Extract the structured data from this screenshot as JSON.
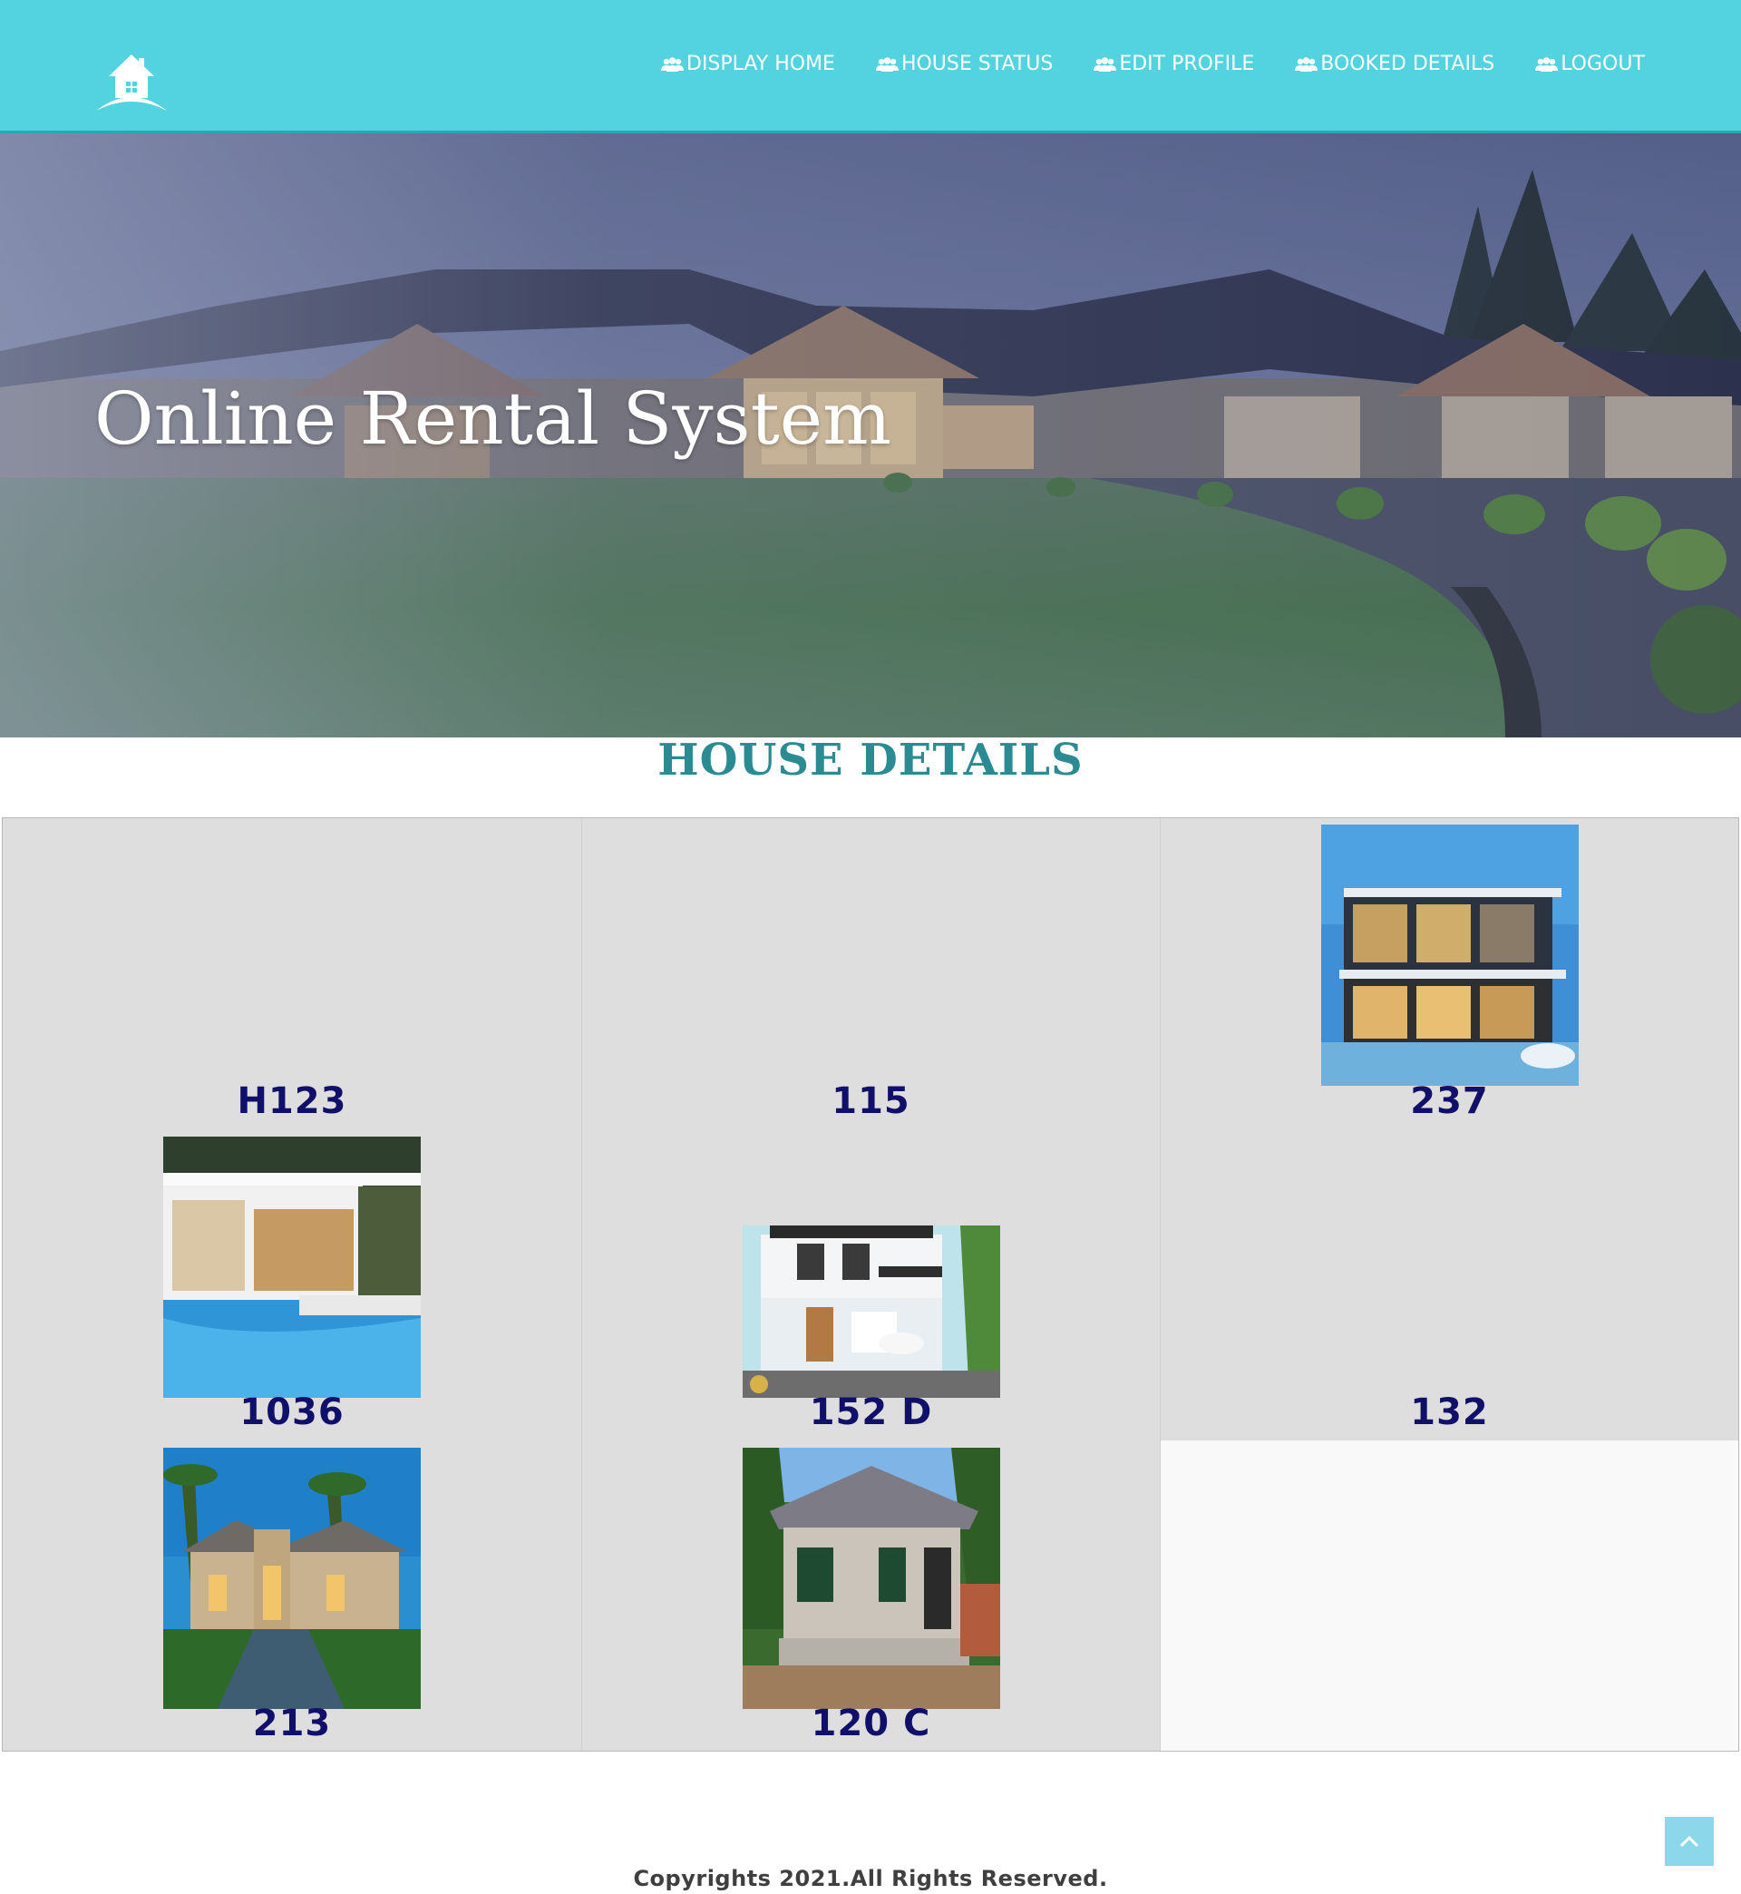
{
  "header": {
    "logo_icon": "house-logo-icon",
    "nav": [
      {
        "label": "DISPLAY HOME",
        "icon": "users-icon"
      },
      {
        "label": "HOUSE STATUS",
        "icon": "users-icon"
      },
      {
        "label": "EDIT PROFILE",
        "icon": "users-icon"
      },
      {
        "label": "BOOKED DETAILS",
        "icon": "users-icon"
      },
      {
        "label": "LOGOUT",
        "icon": "users-icon"
      }
    ]
  },
  "hero": {
    "title": "Online Rental System"
  },
  "section": {
    "heading": "HOUSE DETAILS"
  },
  "houses": [
    {
      "code": "H123",
      "has_image": false
    },
    {
      "code": "115",
      "has_image": false
    },
    {
      "code": "237",
      "has_image": true
    },
    {
      "code": "1036",
      "has_image": true
    },
    {
      "code": "152 D",
      "has_image": true
    },
    {
      "code": "132",
      "has_image": false
    },
    {
      "code": "213",
      "has_image": true
    },
    {
      "code": "120 C",
      "has_image": true
    }
  ],
  "footer": {
    "copyright": "Copyrights 2021.All Rights Reserved.",
    "to_top_icon": "chevron-up-icon"
  },
  "colors": {
    "header_bg": "#52d3df",
    "heading": "#2a8b93",
    "house_code": "#10106b",
    "grid_cell": "#dedede"
  }
}
